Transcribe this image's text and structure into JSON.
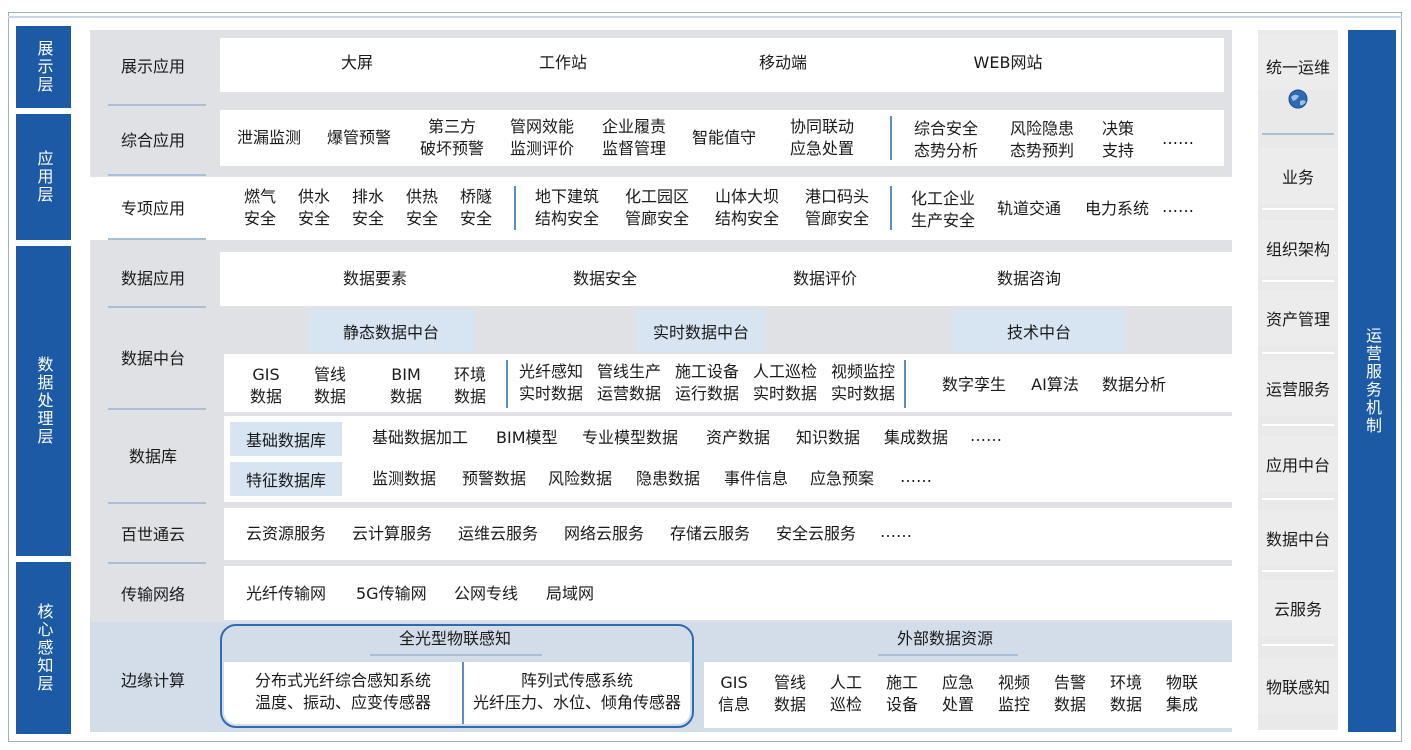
{
  "layers": {
    "display": "展示层",
    "application": "应用层",
    "data_processing": "数据处理层",
    "core_perception": "核心感知层"
  },
  "rows": {
    "display_app": "展示应用",
    "comprehensive_app": "综合应用",
    "special_app": "专项应用",
    "data_app": "数据应用",
    "data_platform": "数据中台",
    "database": "数据库",
    "baishi_cloud": "百世通云",
    "transport": "传输网络",
    "edge": "边缘计算"
  },
  "display_items": [
    "大屏",
    "工作站",
    "移动端",
    "WEB网站"
  ],
  "comprehensive_items": [
    [
      "泄漏监测"
    ],
    [
      "爆管预警"
    ],
    [
      "第三方",
      "破坏预警"
    ],
    [
      "管网效能",
      "监测评价"
    ],
    [
      "企业履责",
      "监督管理"
    ],
    [
      "智能值守"
    ],
    [
      "协同联动",
      "应急处置"
    ],
    [
      "综合安全",
      "态势分析"
    ],
    [
      "风险隐患",
      "态势预判"
    ],
    [
      "决策",
      "支持"
    ],
    [
      "……"
    ]
  ],
  "special_items": [
    [
      "燃气",
      "安全"
    ],
    [
      "供水",
      "安全"
    ],
    [
      "排水",
      "安全"
    ],
    [
      "供热",
      "安全"
    ],
    [
      "桥隧",
      "安全"
    ],
    [
      "地下建筑",
      "结构安全"
    ],
    [
      "化工园区",
      "管廊安全"
    ],
    [
      "山体大坝",
      "结构安全"
    ],
    [
      "港口码头",
      "管廊安全"
    ],
    [
      "化工企业",
      "生产安全"
    ],
    [
      "轨道交通"
    ],
    [
      "电力系统"
    ],
    [
      "……"
    ]
  ],
  "data_app_items": [
    "数据要素",
    "数据安全",
    "数据评价",
    "数据咨询"
  ],
  "platform_headers": [
    "静态数据中台",
    "实时数据中台",
    "技术中台"
  ],
  "platform_items": [
    [
      "GIS",
      "数据"
    ],
    [
      "管线",
      "数据"
    ],
    [
      "BIM",
      "数据"
    ],
    [
      "环境",
      "数据"
    ],
    [
      "光纤感知",
      "实时数据"
    ],
    [
      "管线生产",
      "运营数据"
    ],
    [
      "施工设备",
      "运行数据"
    ],
    [
      "人工巡检",
      "实时数据"
    ],
    [
      "视频监控",
      "实时数据"
    ],
    [
      "数字孪生"
    ],
    [
      "AI算法"
    ],
    [
      "数据分析"
    ]
  ],
  "database": {
    "basic_label": "基础数据库",
    "basic_items": [
      "基础数据加工",
      "BIM模型",
      "专业模型数据",
      "资产数据",
      "知识数据",
      "集成数据",
      "……"
    ],
    "feature_label": "特征数据库",
    "feature_items": [
      "监测数据",
      "预警数据",
      "风险数据",
      "隐患数据",
      "事件信息",
      "应急预案",
      "……"
    ]
  },
  "cloud_items": [
    "云资源服务",
    "云计算服务",
    "运维云服务",
    "网络云服务",
    "存储云服务",
    "安全云服务",
    "……"
  ],
  "transport_items": [
    "光纤传输网",
    "5G传输网",
    "公网专线",
    "局域网"
  ],
  "edge": {
    "optical_title": "全光型物联感知",
    "distributed": [
      "分布式光纤综合感知系统",
      "温度、振动、应变传感器"
    ],
    "array": [
      "阵列式传感系统",
      "光纤压力、水位、倾角传感器"
    ],
    "external_title": "外部数据资源",
    "external_items": [
      [
        "GIS",
        "信息"
      ],
      [
        "管线",
        "数据"
      ],
      [
        "人工",
        "巡检"
      ],
      [
        "施工",
        "设备"
      ],
      [
        "应急",
        "处置"
      ],
      [
        "视频",
        "监控"
      ],
      [
        "告警",
        "数据"
      ],
      [
        "环境",
        "数据"
      ],
      [
        "物联",
        "集成"
      ]
    ]
  },
  "ops_sidebar": [
    "统一运维",
    "业务",
    "组织架构",
    "资产管理",
    "运营服务",
    "应用中台",
    "数据中台",
    "云服务",
    "物联感知"
  ],
  "ops_mechanism": "运营服务机制",
  "colors": {
    "layer_blue": "#1c5aa6",
    "highlight": "#d7e4f2",
    "panel": "#dfe1e4",
    "separator": "#5c8fc6"
  }
}
